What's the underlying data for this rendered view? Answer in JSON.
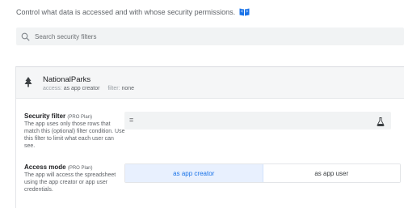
{
  "header": {
    "description": "Control what data is accessed and with whose security permissions.",
    "help_icon": "book-icon",
    "accent_color": "#1a73e8"
  },
  "search": {
    "placeholder": "Search security filters",
    "value": ""
  },
  "table": {
    "name": "NationalParks",
    "access_label": "access:",
    "access_value": "as app creator",
    "filter_label": "filter:",
    "filter_value": "none",
    "icon": "tree-icon"
  },
  "security_filter": {
    "title": "Security filter",
    "plan": "(PRO Plan)",
    "description": "The app uses only those rows that match this (optional) filter condition. Use this filter to limit what each user can see.",
    "value": "=",
    "tool_icon": "flask-icon"
  },
  "access_mode": {
    "title": "Access mode",
    "plan": "(PRO Plan)",
    "description": "The app will access the spreadsheet using the app creator or app user credentials.",
    "options": [
      "as app creator",
      "as app user"
    ],
    "selected": "as app creator"
  }
}
